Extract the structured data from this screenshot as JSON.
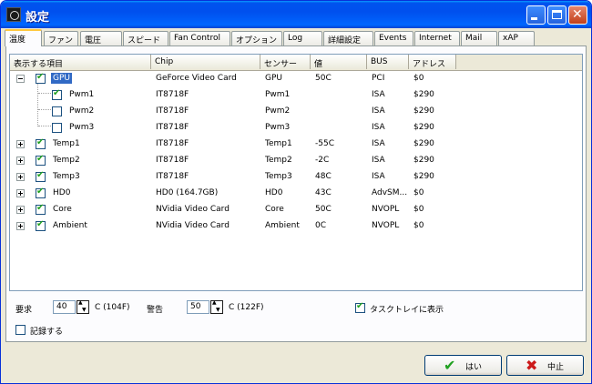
{
  "window": {
    "title": "設定"
  },
  "tabs": [
    "温度",
    "ファン",
    "電圧",
    "スピード",
    "Fan Control",
    "オプション",
    "Log",
    "詳細設定",
    "Events",
    "Internet",
    "Mail",
    "xAP"
  ],
  "columns": [
    "表示する項目",
    "Chip",
    "センサー",
    "値",
    "BUS",
    "アドレス"
  ],
  "rows": [
    {
      "name": "GPU",
      "chip": "GeForce Video Card",
      "sensor": "GPU",
      "value": "50C",
      "bus": "PCI",
      "address": "$0"
    },
    {
      "name": "Pwm1",
      "chip": "IT8718F",
      "sensor": "Pwm1",
      "value": "",
      "bus": "ISA",
      "address": "$290"
    },
    {
      "name": "Pwm2",
      "chip": "IT8718F",
      "sensor": "Pwm2",
      "value": "",
      "bus": "ISA",
      "address": "$290"
    },
    {
      "name": "Pwm3",
      "chip": "IT8718F",
      "sensor": "Pwm3",
      "value": "",
      "bus": "ISA",
      "address": "$290"
    },
    {
      "name": "Temp1",
      "chip": "IT8718F",
      "sensor": "Temp1",
      "value": "-55C",
      "bus": "ISA",
      "address": "$290"
    },
    {
      "name": "Temp2",
      "chip": "IT8718F",
      "sensor": "Temp2",
      "value": "-2C",
      "bus": "ISA",
      "address": "$290"
    },
    {
      "name": "Temp3",
      "chip": "IT8718F",
      "sensor": "Temp3",
      "value": "48C",
      "bus": "ISA",
      "address": "$290"
    },
    {
      "name": "HD0",
      "chip": "HD0 (164.7GB)",
      "sensor": "HD0",
      "value": "43C",
      "bus": "AdvSM...",
      "address": "$0"
    },
    {
      "name": "Core",
      "chip": "NVidia Video Card",
      "sensor": "Core",
      "value": "50C",
      "bus": "NVOPL",
      "address": "$0"
    },
    {
      "name": "Ambient",
      "chip": "NVidia Video Card",
      "sensor": "Ambient",
      "value": "0C",
      "bus": "NVOPL",
      "address": "$0"
    }
  ],
  "bottom": {
    "request_label": "要求",
    "request_value": "40",
    "request_unit": "C (104F)",
    "warning_label": "警告",
    "warning_value": "50",
    "warning_unit": "C (122F)",
    "tray_label": "タスクトレイに表示",
    "log_label": "記録する"
  },
  "buttons": {
    "ok": "はい",
    "cancel": "中止"
  }
}
